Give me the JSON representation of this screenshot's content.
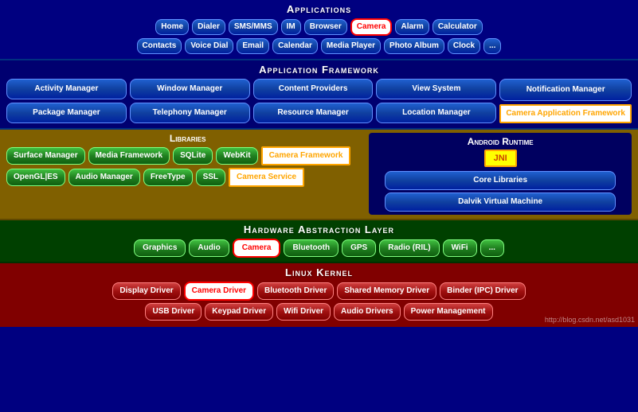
{
  "applications": {
    "title": "Applications",
    "row1": [
      "Home",
      "Dialer",
      "SMS/MMS",
      "IM",
      "Browser",
      "Camera",
      "Alarm",
      "Calculator"
    ],
    "row2": [
      "Contacts",
      "Voice Dial",
      "Email",
      "Calendar",
      "Media Player",
      "Photo Album",
      "Clock",
      "..."
    ],
    "highlight": "Camera"
  },
  "framework": {
    "title": "Application Framework",
    "items": [
      {
        "label": "Activity Manager",
        "span": 1
      },
      {
        "label": "Window Manager",
        "span": 1
      },
      {
        "label": "Content Providers",
        "span": 1
      },
      {
        "label": "View System",
        "span": 1
      },
      {
        "label": "Notification Manager",
        "span": 1
      },
      {
        "label": "Package Manager",
        "span": 1
      },
      {
        "label": "Telephony Manager",
        "span": 1
      },
      {
        "label": "Resource Manager",
        "span": 1
      },
      {
        "label": "Location Manager",
        "span": 1
      }
    ],
    "highlight_badge": "Camera Application Framework"
  },
  "libraries": {
    "title": "Libraries",
    "row1": [
      "Surface Manager",
      "Media Framework",
      "SQLite",
      "WebKit"
    ],
    "row2": [
      "OpenGL|ES",
      "Audio Manager",
      "FreeType",
      "SSL"
    ],
    "camera_fw": "Camera Framework",
    "camera_service": "Camera Service"
  },
  "runtime": {
    "title": "Android Runtime",
    "core_libs": "Core Libraries",
    "jni": "JNI",
    "dvm": "Dalvik Virtual Machine"
  },
  "hal": {
    "title": "Hardware Abstraction Layer",
    "items": [
      "Graphics",
      "Audio",
      "Camera",
      "Bluetooth",
      "GPS",
      "Radio (RIL)",
      "WiFi",
      "..."
    ],
    "highlight": "Camera"
  },
  "kernel": {
    "title": "Linux Kernel",
    "row1": [
      "Display Driver",
      "Camera Driver",
      "Bluetooth Driver",
      "Shared Memory Driver",
      "Binder (IPC) Driver"
    ],
    "row2": [
      "USB Driver",
      "Keypad Driver",
      "Wifi Driver",
      "Audio Drivers",
      "Power Management"
    ],
    "highlight": "Camera Driver",
    "watermark": "http://blog.csdn.net/asd1031"
  }
}
